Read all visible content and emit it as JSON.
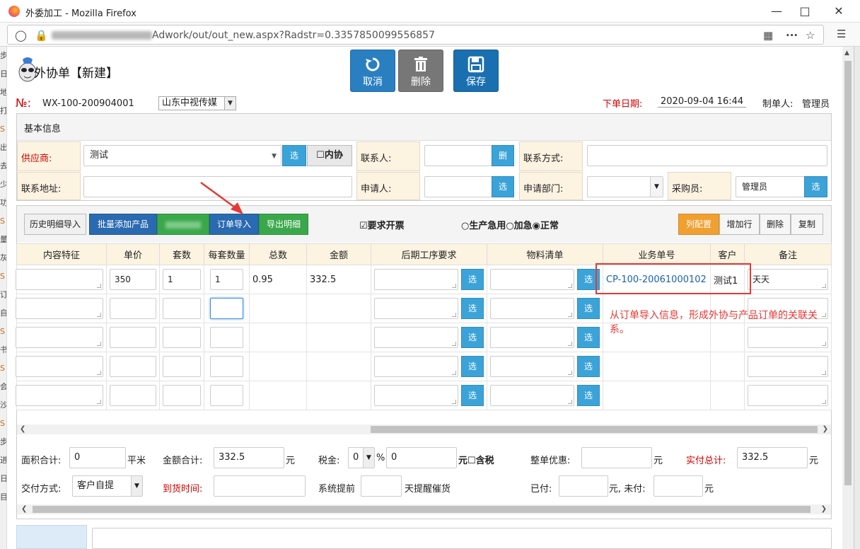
{
  "window": {
    "title": "外委加工 - Mozilla Firefox",
    "url_tail": "Adwork/out/out_new.aspx?Radstr=0.3357850099556857",
    "url_head": "112.255.148.117:88"
  },
  "header": {
    "title": "外协单【新建】",
    "buttons": {
      "cancel": "取消",
      "delete": "删除",
      "save": "保存"
    },
    "no_label": "№:",
    "no_value": "WX-100-200904001",
    "company": "山东中视传媒",
    "order_date_label": "下单日期:",
    "order_date_value": "2020-09-04 16:44",
    "maker_label": "制单人:",
    "maker_value": "管理员"
  },
  "basic": {
    "section_title": "基本信息",
    "supplier_label": "供应商:",
    "supplier_value": "测试",
    "choose": "选",
    "internal": "☐内协",
    "contact_label": "联系人:",
    "delete_short": "删",
    "contact_method_label": "联系方式:",
    "address_label": "联系地址:",
    "applicant_label": "申请人:",
    "dept_label": "申请部门:",
    "buyer_label": "采购员:",
    "buyer_value": "管理员"
  },
  "toolbar": {
    "history_import": "历史明细导入",
    "batch_add": "批量添加产品",
    "order_import": "订单导入",
    "export_detail": "导出明细",
    "require_invoice": "☑要求开票",
    "urgency": "○生产急用○加急◉正常",
    "col_config": "列配置",
    "add_row": "增加行",
    "delete": "删除",
    "copy": "复制"
  },
  "table": {
    "columns": [
      "内容特征",
      "单价",
      "套数",
      "每套数量",
      "总数",
      "金额",
      "后期工序要求",
      "物料清单",
      "业务单号",
      "客户",
      "备注"
    ],
    "choose": "选",
    "rows": [
      {
        "feature": "",
        "price": "350",
        "sets": "1",
        "per_set": "1",
        "total": "0.95",
        "amount": "332.5",
        "order_no": "CP-100-20061000102",
        "customer": "测试1",
        "remark": "天天"
      },
      {
        "feature": "",
        "price": "",
        "sets": "",
        "per_set": "",
        "total": "",
        "amount": "",
        "order_no": "",
        "customer": "",
        "remark": ""
      },
      {
        "feature": "",
        "price": "",
        "sets": "",
        "per_set": "",
        "total": "",
        "amount": "",
        "order_no": "",
        "customer": "",
        "remark": ""
      },
      {
        "feature": "",
        "price": "",
        "sets": "",
        "per_set": "",
        "total": "",
        "amount": "",
        "order_no": "",
        "customer": "",
        "remark": ""
      },
      {
        "feature": "",
        "price": "",
        "sets": "",
        "per_set": "",
        "total": "",
        "amount": "",
        "order_no": "",
        "customer": "",
        "remark": ""
      }
    ]
  },
  "annotation": "从订单导入信息，形成外协与产品订单的关联关系。",
  "footer": {
    "area_label": "面积合计:",
    "area_value": "0",
    "area_unit": "平米",
    "amount_label": "金额合计:",
    "amount_value": "332.5",
    "yuan": "元",
    "tax_label": "税金:",
    "tax_rate": "0",
    "percent": "%",
    "tax_value": "0",
    "tax_included": "元☐含税",
    "discount_label": "整单优惠:",
    "actual_label": "实付总计:",
    "actual_value": "332.5",
    "delivery_label": "交付方式:",
    "delivery_value": "客户自提",
    "arrival_label": "到货时间:",
    "remind_label": "系统提前",
    "remind_tail": "天提醒催货",
    "paid_label": "已付:",
    "unpaid_label": "元, 未付:",
    "yuan_end": "元"
  },
  "side": {
    "left_chars": [
      "步",
      "日",
      "地",
      "打",
      "S",
      "出",
      "去",
      "少",
      "功",
      "S",
      "量",
      "灰",
      "S",
      "订",
      "自",
      "S",
      "书",
      "S",
      "会",
      "沙",
      "S",
      "步",
      "进",
      "日",
      "目"
    ]
  }
}
